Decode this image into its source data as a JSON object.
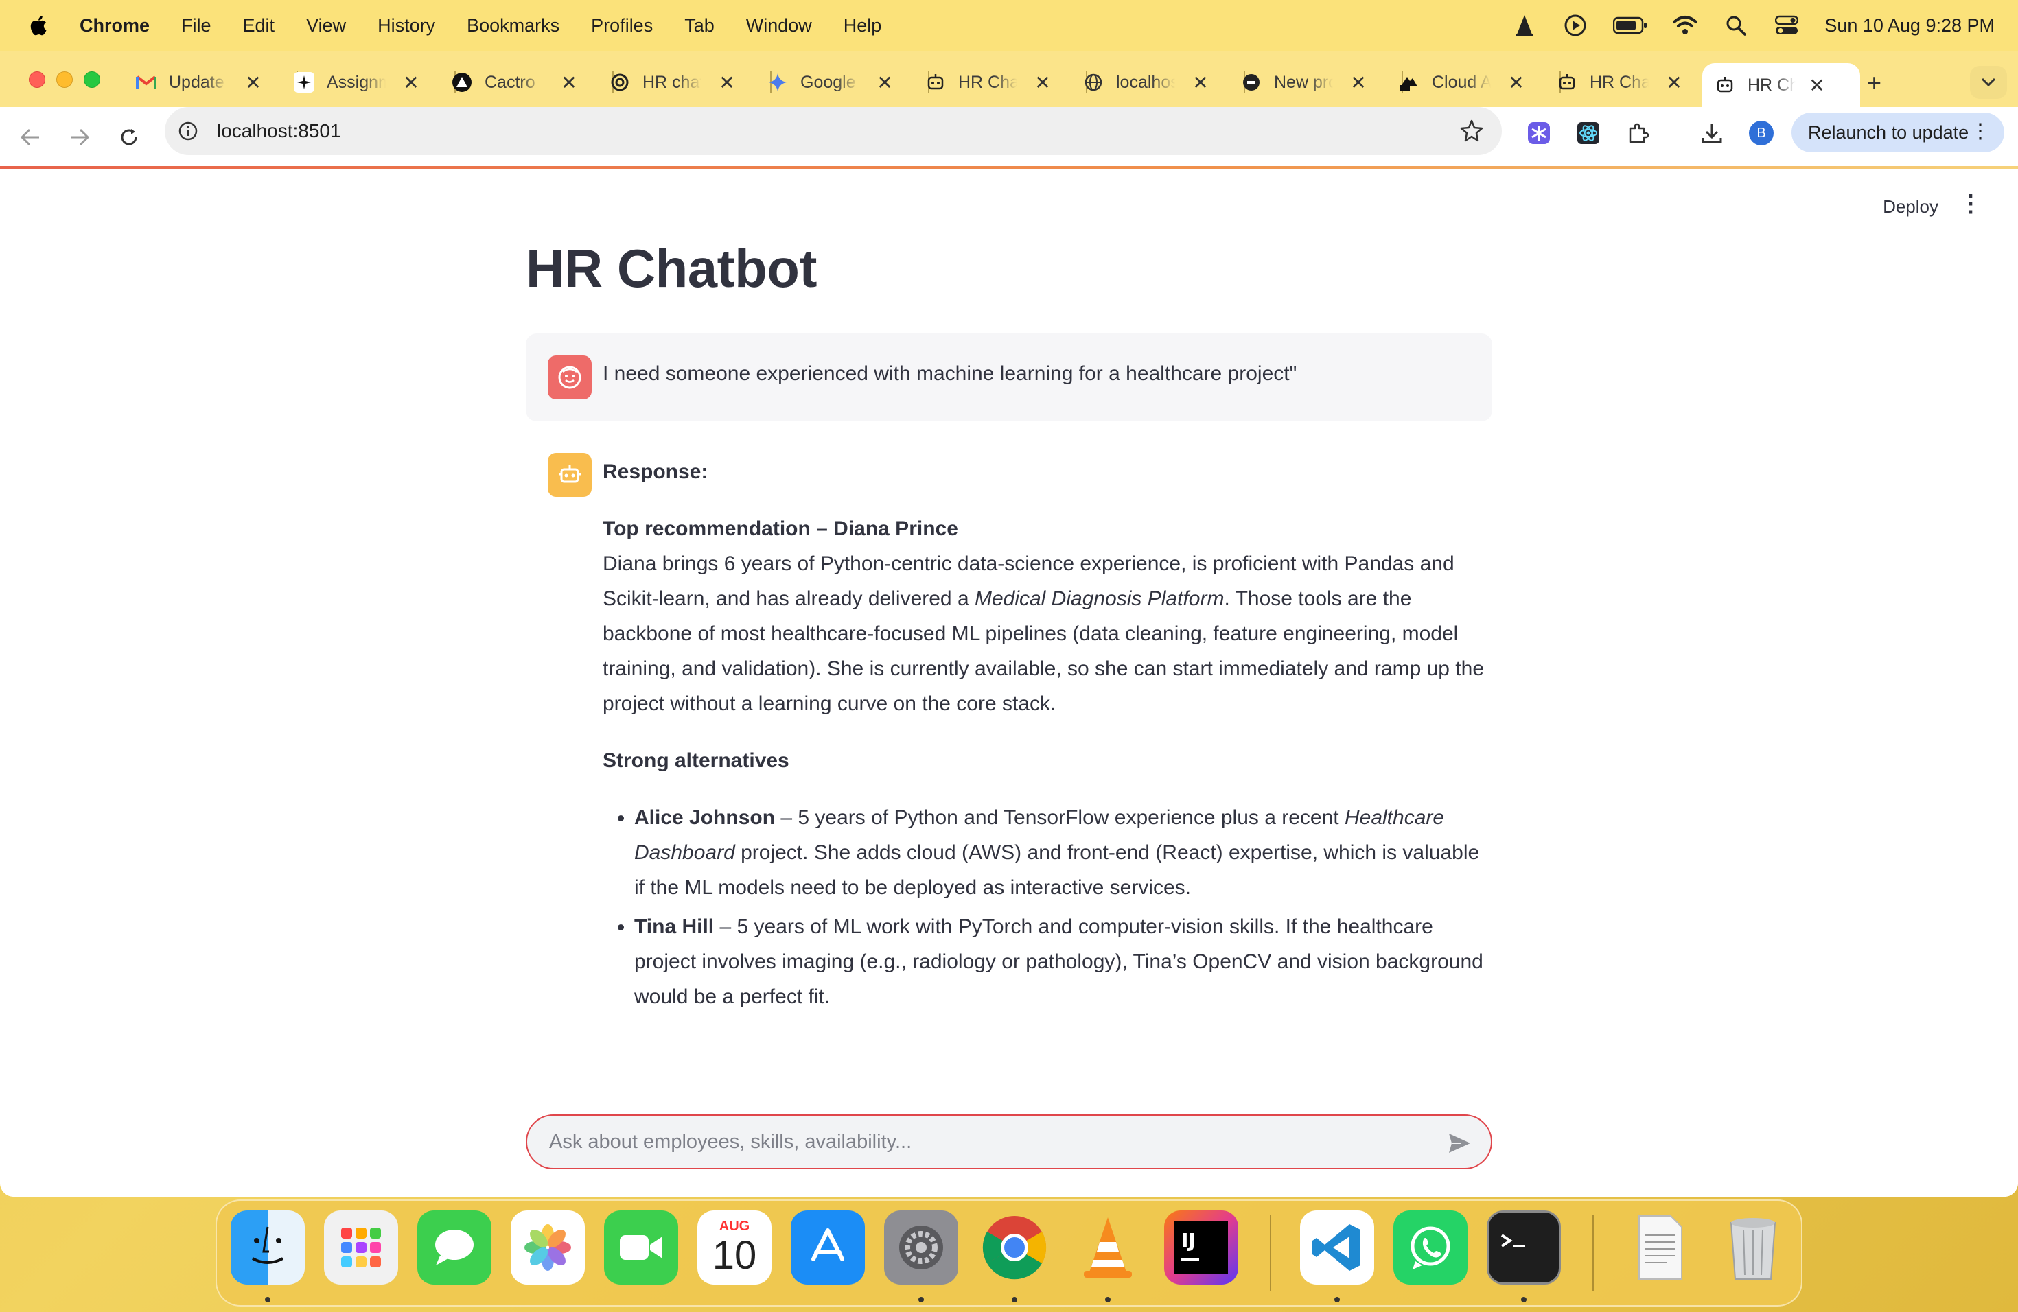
{
  "menubar": {
    "app_name": "Chrome",
    "menus": [
      "File",
      "Edit",
      "View",
      "History",
      "Bookmarks",
      "Profiles",
      "Tab",
      "Window",
      "Help"
    ],
    "clock": "Sun 10 Aug  9:28 PM",
    "status_icons": [
      "vlc-icon",
      "play-icon",
      "battery-icon",
      "wifi-icon",
      "search-icon",
      "control-center-icon"
    ]
  },
  "browser": {
    "tabs": [
      {
        "label": "Update",
        "icon": "gmail-icon"
      },
      {
        "label": "Assignm",
        "icon": "sparkle-icon"
      },
      {
        "label": "Cactro",
        "icon": "triangle-icon"
      },
      {
        "label": "HR chat",
        "icon": "openai-icon"
      },
      {
        "label": "Google",
        "icon": "gemini-icon"
      },
      {
        "label": "HR Cha",
        "icon": "robot-icon"
      },
      {
        "label": "localhos",
        "icon": "globe-icon"
      },
      {
        "label": "New pro",
        "icon": "notion-icon"
      },
      {
        "label": "Cloud A",
        "icon": "cloud-icon"
      },
      {
        "label": "HR Cha",
        "icon": "robot-icon"
      },
      {
        "label": "HR Cha",
        "icon": "robot-icon",
        "active": true
      }
    ],
    "url": "localhost:8501",
    "relaunch_label": "Relaunch to update",
    "profile_initial": "B"
  },
  "app": {
    "deploy_label": "Deploy",
    "title": "HR Chatbot",
    "user_message": "I need someone experienced with machine learning for a healthcare project\"",
    "response": {
      "label": "Response:",
      "top_heading": "Top recommendation – Diana Prince",
      "top_paragraph_parts": [
        "Diana brings 6 years of Python‑centric data‑science experience, is proficient with Pandas and Scikit‑learn, and has already delivered a ",
        "Medical Diagnosis Platform",
        ". Those tools are the backbone of most healthcare‑focused ML pipelines (data cleaning, feature engineering, model training, and validation). She is currently available, so she can start immediately and ramp up the project without a learning curve on the core stack."
      ],
      "alt_heading": "Strong alternatives",
      "alternatives": [
        {
          "name": "Alice Johnson",
          "text_a": " – 5 years of Python and TensorFlow experience plus a recent ",
          "italic": "Healthcare Dashboard",
          "text_b": " project. She adds cloud (AWS) and front‑end (React) expertise, which is valuable if the ML models need to be deployed as interactive services."
        },
        {
          "name": "Tina Hill",
          "text_a": " – 5 years of ML work with PyTorch and computer‑vision skills. If the healthcare project involves imaging (e.g., radiology or pathology), Tina’s OpenCV and vision background would be a perfect fit.",
          "italic": "",
          "text_b": ""
        }
      ]
    },
    "chat_input_placeholder": "Ask about employees, skills, availability..."
  },
  "dock": {
    "calendar_month": "AUG",
    "calendar_day": "10",
    "apps": [
      "finder-icon",
      "launchpad-icon",
      "messages-icon",
      "photos-icon",
      "facetime-icon",
      "calendar-icon",
      "app-store-icon",
      "system-settings-icon",
      "chrome-icon",
      "vlc-icon",
      "intellij-icon",
      "vscode-icon",
      "whatsapp-icon",
      "terminal-icon",
      "document-icon",
      "trash-icon"
    ]
  },
  "colors": {
    "menubar_bg": "#fbe27a",
    "tabstrip_bg": "#fbe48a",
    "user_avatar": "#ee6b69",
    "bot_avatar": "#f9bd4e",
    "chat_input_border": "#e0464b",
    "relaunch_bg": "#d5e3fa"
  }
}
